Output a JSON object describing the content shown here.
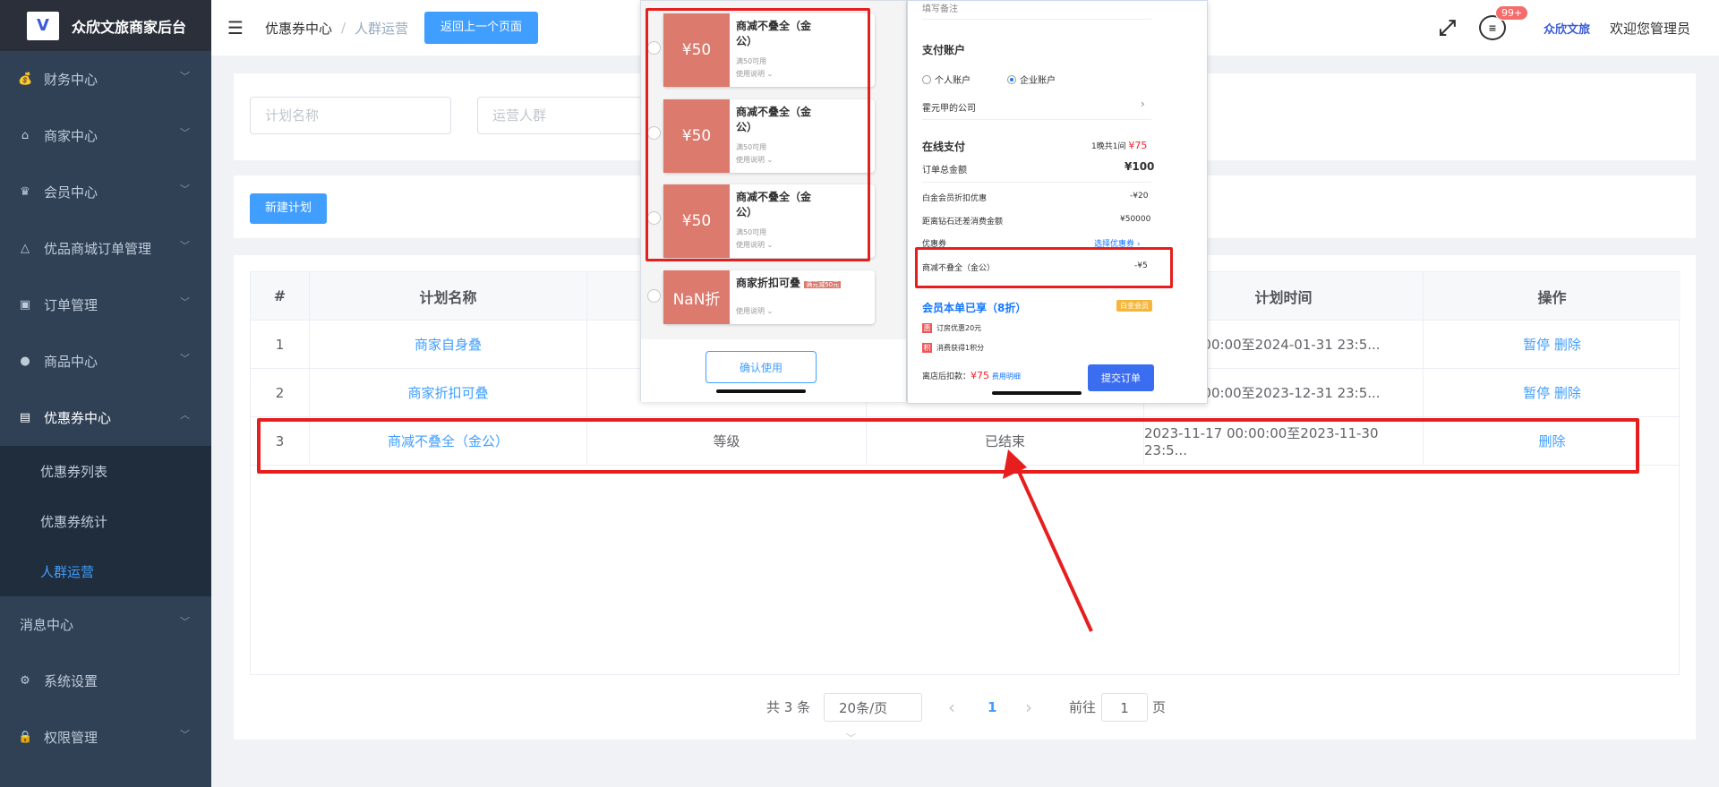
{
  "app": {
    "logo_text": "V",
    "title": "众欣文旅商家后台"
  },
  "sidebar": {
    "items": [
      {
        "label": "财务中心",
        "icon": "money-bag-icon"
      },
      {
        "label": "商家中心",
        "icon": "shop-icon"
      },
      {
        "label": "会员中心",
        "icon": "crown-icon"
      },
      {
        "label": "优品商城订单管理",
        "icon": "bag-icon"
      },
      {
        "label": "订单管理",
        "icon": "clipboard-icon"
      },
      {
        "label": "商品中心",
        "icon": "product-icon"
      },
      {
        "label": "优惠券中心",
        "icon": "ticket-icon"
      }
    ],
    "coupon_sub": [
      "优惠券列表",
      "优惠券统计",
      "人群运营"
    ],
    "bottom_items": [
      {
        "label": "消息中心"
      },
      {
        "label": "系统设置",
        "icon": "gear-icon"
      },
      {
        "label": "权限管理",
        "icon": "lock-icon"
      }
    ]
  },
  "header": {
    "breadcrumb": [
      "优惠券中心",
      "人群运营"
    ],
    "breadcrumb_sep": "/",
    "back_button": "返回上一个页面",
    "badge": "99+",
    "mini_logo": "众欣文旅",
    "welcome": "欢迎您管理员"
  },
  "search": {
    "plan_name_placeholder": "计划名称",
    "crowd_placeholder": "运营人群"
  },
  "actions": {
    "new_plan": "新建计划"
  },
  "table": {
    "headers": [
      "#",
      "计划名称",
      "",
      "",
      "计划时间",
      "操作"
    ],
    "rows": [
      {
        "no": "1",
        "name": "商家自身叠",
        "crowd": "",
        "status": "",
        "time": "-01 00:00:00至2024-01-31 23:5...",
        "ops": [
          "暂停",
          "删除"
        ]
      },
      {
        "no": "2",
        "name": "商家折扣可叠",
        "crowd": "",
        "status": "",
        "time": "-29 00:00:00至2023-12-31 23:5...",
        "ops": [
          "暂停",
          "删除"
        ]
      },
      {
        "no": "3",
        "name": "商减不叠全（金公）",
        "crowd": "等级",
        "status": "已结束",
        "time": "2023-11-17 00:00:00至2023-11-30 23:5...",
        "ops": [
          "删除"
        ]
      }
    ]
  },
  "pager": {
    "total": "共 3 条",
    "page_size": "20条/页",
    "prev": "‹",
    "current": "1",
    "next": "›",
    "goto": "前往",
    "goto_value": "1",
    "page_unit": "页"
  },
  "overlay_coupons": {
    "coupons": [
      {
        "amount": "¥50",
        "title": "商减不叠全（金公）",
        "sub": "满50可用",
        "rule": "使用说明"
      },
      {
        "amount": "¥50",
        "title": "商减不叠全（金公）",
        "sub": "满50可用",
        "rule": "使用说明"
      },
      {
        "amount": "¥50",
        "title": "商减不叠全（金公）",
        "sub": "满50可用",
        "rule": "使用说明"
      },
      {
        "amount": "NaN折",
        "title": "商家折扣可叠",
        "tag": "满元减50元",
        "rule": "使用说明"
      }
    ],
    "confirm": "确认使用"
  },
  "overlay_order": {
    "remark_placeholder": "填写备注",
    "pay_account": "支付账户",
    "personal": "个人账户",
    "company": "企业账户",
    "company_name": "霍元甲的公司",
    "online_pay": "在线支付",
    "nights": "1晚共1间",
    "pay_amount": "¥75",
    "order_total_label": "订单总金额",
    "order_total": "¥100",
    "vip_discount_label": "白金会员折扣优惠",
    "vip_discount": "-¥20",
    "diamond_label": "距离钻石还差消费金额",
    "diamond_value": "¥50000",
    "coupon_label": "优惠券",
    "coupon_select": "选择优惠券",
    "coupon_used": "商减不叠全（金公）",
    "coupon_used_value": "-¥5",
    "member_enjoy": "会员本单已享（8折）",
    "gold_tag": "白金会员",
    "perk1": "订房优惠20元",
    "perk2": "消费获得1积分",
    "after_discount_label": "离店后扣款：",
    "after_discount": "¥75",
    "fee_detail": "费用明细",
    "submit": "提交订单"
  },
  "colors": {
    "sidebar_bg": "#304156",
    "accent": "#409eff",
    "highlight": "#e61e1e",
    "coupon": "#dc7a6d"
  }
}
